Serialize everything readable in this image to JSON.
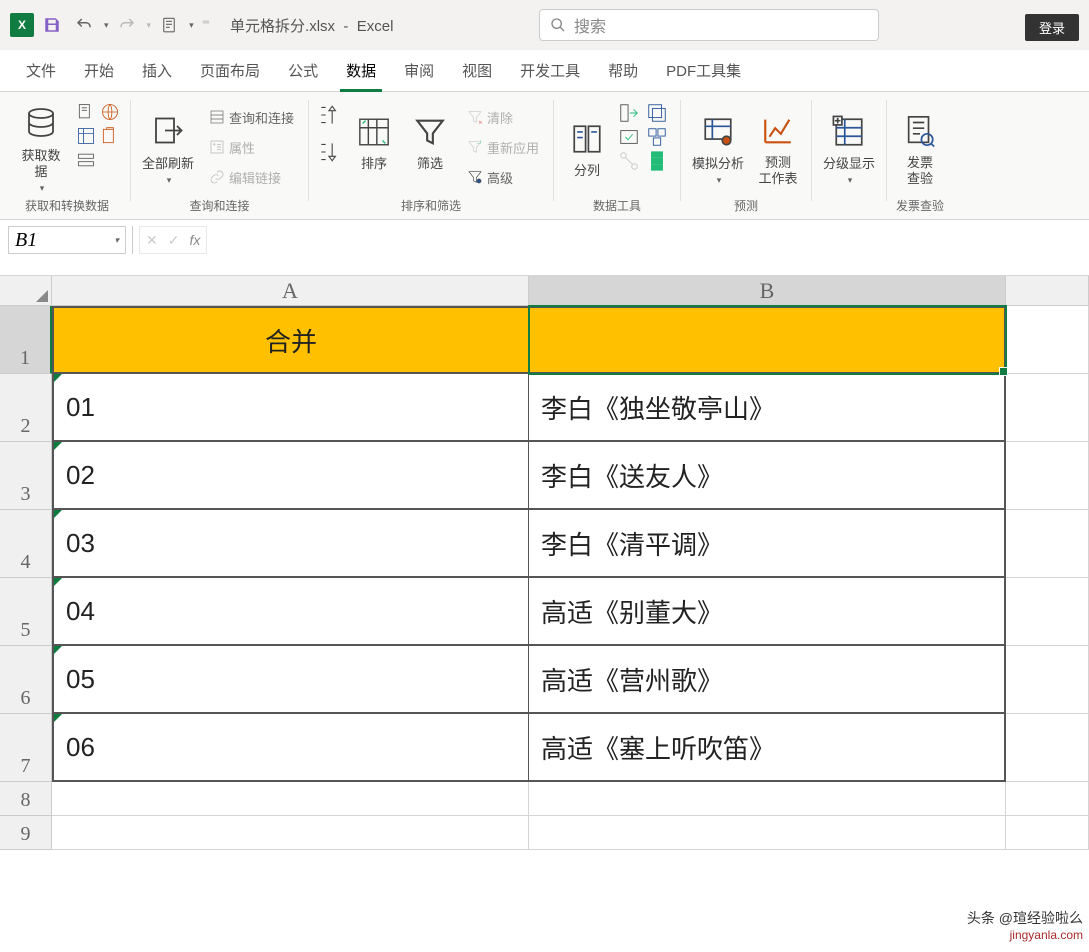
{
  "titlebar": {
    "doc_title": "单元格拆分.xlsx",
    "app_name": "Excel",
    "search_placeholder": "搜索",
    "login": "登录"
  },
  "tabs": {
    "items": [
      "文件",
      "开始",
      "插入",
      "页面布局",
      "公式",
      "数据",
      "审阅",
      "视图",
      "开发工具",
      "帮助",
      "PDF工具集"
    ],
    "active_index": 5
  },
  "ribbon": {
    "group1": {
      "label": "获取和转换数据",
      "main": "获取数\n据"
    },
    "group2": {
      "label": "查询和连接",
      "main": "全部刷新",
      "items": [
        "查询和连接",
        "属性",
        "编辑链接"
      ]
    },
    "group3": {
      "label": "排序和筛选",
      "sort": "排序",
      "filter": "筛选",
      "items": [
        "清除",
        "重新应用",
        "高级"
      ]
    },
    "group4": {
      "label": "数据工具",
      "main": "分列"
    },
    "group5": {
      "label": "预测",
      "a": "模拟分析",
      "b": "预测\n工作表"
    },
    "group6": {
      "label": "",
      "main": "分级显示"
    },
    "group7": {
      "label": "发票查验",
      "main": "发票\n查验"
    }
  },
  "formula": {
    "name_box": "B1"
  },
  "sheet": {
    "columns": [
      "A",
      "B"
    ],
    "header_row": {
      "a": "合并",
      "b": ""
    },
    "data": [
      {
        "a": "01",
        "b": "李白《独坐敬亭山》"
      },
      {
        "a": "02",
        "b": "李白《送友人》"
      },
      {
        "a": "03",
        "b": "李白《清平调》"
      },
      {
        "a": "04",
        "b": "高适《别董大》"
      },
      {
        "a": "05",
        "b": "高适《营州歌》"
      },
      {
        "a": "06",
        "b": "高适《塞上听吹笛》"
      }
    ],
    "row_numbers": [
      1,
      2,
      3,
      4,
      5,
      6,
      7,
      8,
      9
    ],
    "selected_cell": "B1"
  },
  "watermark": {
    "line1": "头条 @瑄经验啦么",
    "line2": "jingyanla.com"
  }
}
